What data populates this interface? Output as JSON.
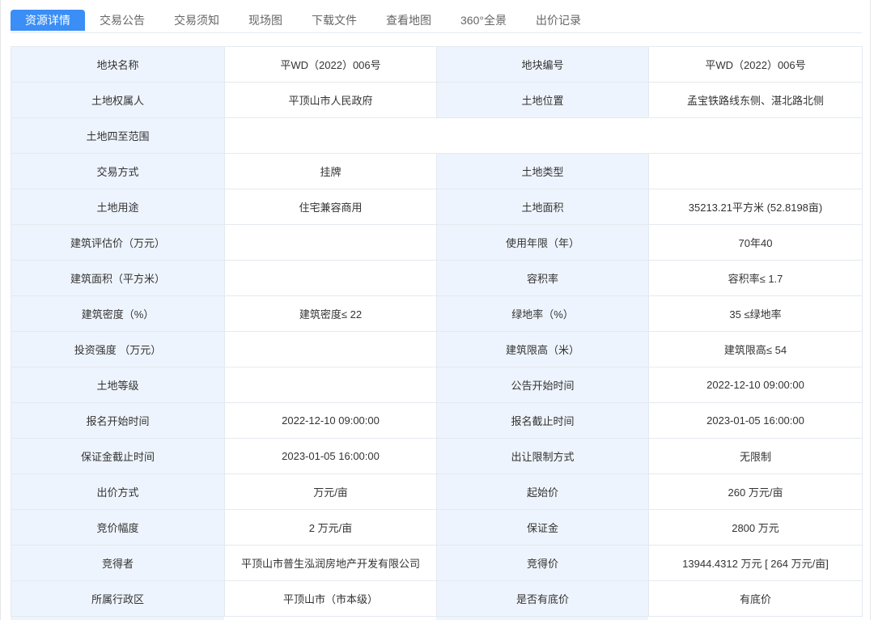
{
  "tabs": [
    {
      "label": "资源详情",
      "active": true
    },
    {
      "label": "交易公告",
      "active": false
    },
    {
      "label": "交易须知",
      "active": false
    },
    {
      "label": "现场图",
      "active": false
    },
    {
      "label": "下载文件",
      "active": false
    },
    {
      "label": "查看地图",
      "active": false
    },
    {
      "label": "360°全景",
      "active": false
    },
    {
      "label": "出价记录",
      "active": false
    }
  ],
  "colors": {
    "accent": "#3a8ef6",
    "label_background": "#eef4fd",
    "border": "#e5e9ef",
    "text": "#333333",
    "tab_text": "#666666"
  },
  "details": [
    [
      {
        "label": "地块名称",
        "value": "平WD（2022）006号"
      },
      {
        "label": "地块编号",
        "value": "平WD（2022）006号"
      }
    ],
    [
      {
        "label": "土地权属人",
        "value": "平顶山市人民政府"
      },
      {
        "label": "土地位置",
        "value": "孟宝铁路线东侧、湛北路北侧"
      }
    ],
    [
      {
        "label": "土地四至范围",
        "value": ""
      }
    ],
    [
      {
        "label": "交易方式",
        "value": "挂牌"
      },
      {
        "label": "土地类型",
        "value": ""
      }
    ],
    [
      {
        "label": "土地用途",
        "value": "住宅兼容商用"
      },
      {
        "label": "土地面积",
        "value": "35213.21平方米 (52.8198亩)"
      }
    ],
    [
      {
        "label": "建筑评估价（万元）",
        "value": ""
      },
      {
        "label": "使用年限（年）",
        "value": "70年40"
      }
    ],
    [
      {
        "label": "建筑面积（平方米）",
        "value": ""
      },
      {
        "label": "容积率",
        "value": "容积率≤ 1.7"
      }
    ],
    [
      {
        "label": "建筑密度（%）",
        "value": "建筑密度≤ 22"
      },
      {
        "label": "绿地率（%）",
        "value": "35 ≤绿地率"
      }
    ],
    [
      {
        "label": "投资强度 （万元）",
        "value": ""
      },
      {
        "label": "建筑限高（米）",
        "value": "建筑限高≤ 54"
      }
    ],
    [
      {
        "label": "土地等级",
        "value": ""
      },
      {
        "label": "公告开始时间",
        "value": "2022-12-10 09:00:00"
      }
    ],
    [
      {
        "label": "报名开始时间",
        "value": "2022-12-10 09:00:00"
      },
      {
        "label": "报名截止时间",
        "value": "2023-01-05 16:00:00"
      }
    ],
    [
      {
        "label": "保证金截止时间",
        "value": "2023-01-05 16:00:00"
      },
      {
        "label": "出让限制方式",
        "value": "无限制"
      }
    ],
    [
      {
        "label": "出价方式",
        "value": "万元/亩"
      },
      {
        "label": "起始价",
        "value": "260 万元/亩"
      }
    ],
    [
      {
        "label": "竞价幅度",
        "value": "2 万元/亩"
      },
      {
        "label": "保证金",
        "value": "2800 万元"
      }
    ],
    [
      {
        "label": "竞得者",
        "value": "平顶山市普生泓润房地产开发有限公司"
      },
      {
        "label": "竞得价",
        "value": "13944.4312 万元 [ 264 万元/亩]"
      }
    ],
    [
      {
        "label": "所属行政区",
        "value": "平顶山市（市本级）"
      },
      {
        "label": "是否有底价",
        "value": "有底价"
      }
    ]
  ]
}
